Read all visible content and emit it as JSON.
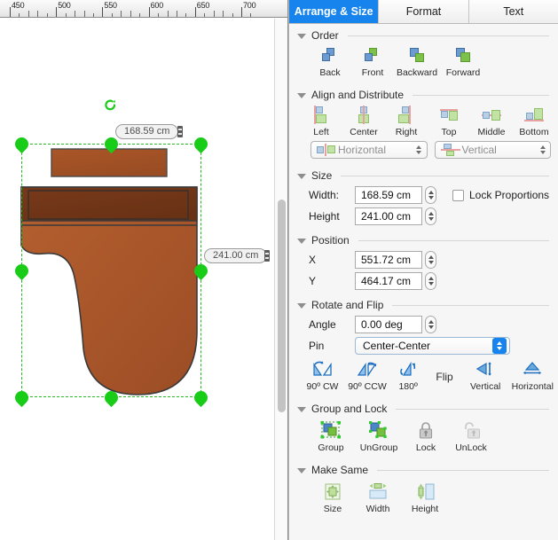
{
  "canvas": {
    "ruler": {
      "unit_labels": [
        "450",
        "500",
        "550",
        "600",
        "650",
        "700"
      ],
      "start": 450,
      "end": 710
    },
    "selection": {
      "width_badge": "168.59 cm",
      "height_badge": "241.00 cm",
      "handle_color": "#18cc18",
      "guide_color": "#22bb22",
      "rotate_icon": "rotate-handle-icon"
    },
    "shape": {
      "name": "bed-shape",
      "fill_color": "#a8552a",
      "dark_fill_color": "#6e3517",
      "stroke_color": "#3b3b3b"
    },
    "scrollbar": {
      "name": "vertical-scrollbar"
    }
  },
  "inspector": {
    "tabs": [
      {
        "label": "Arrange & Size",
        "active": true
      },
      {
        "label": "Format",
        "active": false
      },
      {
        "label": "Text",
        "active": false
      }
    ],
    "order": {
      "title": "Order",
      "buttons": [
        {
          "label": "Back",
          "icon": "send-to-back-icon"
        },
        {
          "label": "Front",
          "icon": "bring-to-front-icon"
        },
        {
          "label": "Backward",
          "icon": "send-backward-icon"
        },
        {
          "label": "Forward",
          "icon": "bring-forward-icon"
        }
      ]
    },
    "align": {
      "title": "Align and Distribute",
      "buttons": [
        {
          "label": "Left",
          "icon": "align-left-icon"
        },
        {
          "label": "Center",
          "icon": "align-center-icon"
        },
        {
          "label": "Right",
          "icon": "align-right-icon"
        },
        {
          "label": "Top",
          "icon": "align-top-icon"
        },
        {
          "label": "Middle",
          "icon": "align-middle-icon"
        },
        {
          "label": "Bottom",
          "icon": "align-bottom-icon"
        }
      ],
      "distribute_horizontal": "Horizontal",
      "distribute_vertical": "Vertical"
    },
    "size": {
      "title": "Size",
      "width_label": "Width:",
      "width_value": "168.59 cm",
      "height_label": "Height",
      "height_value": "241.00 cm",
      "lock_proportions_label": "Lock Proportions",
      "lock_proportions_checked": false
    },
    "position": {
      "title": "Position",
      "x_label": "X",
      "x_value": "551.72 cm",
      "y_label": "Y",
      "y_value": "464.17 cm"
    },
    "rotate": {
      "title": "Rotate and Flip",
      "angle_label": "Angle",
      "angle_value": "0.00 deg",
      "pin_label": "Pin",
      "pin_value": "Center-Center",
      "buttons": [
        {
          "label": "90º CW",
          "icon": "rotate-90-cw-icon"
        },
        {
          "label": "90º CCW",
          "icon": "rotate-90-ccw-icon"
        },
        {
          "label": "180º",
          "icon": "rotate-180-icon"
        }
      ],
      "flip_label": "Flip",
      "flip_buttons": [
        {
          "label": "Vertical",
          "icon": "flip-vertical-icon"
        },
        {
          "label": "Horizontal",
          "icon": "flip-horizontal-icon"
        }
      ]
    },
    "group": {
      "title": "Group and Lock",
      "buttons": [
        {
          "label": "Group",
          "icon": "group-icon"
        },
        {
          "label": "UnGroup",
          "icon": "ungroup-icon"
        },
        {
          "label": "Lock",
          "icon": "lock-closed-icon"
        },
        {
          "label": "UnLock",
          "icon": "lock-open-icon"
        }
      ]
    },
    "makesame": {
      "title": "Make Same",
      "buttons": [
        {
          "label": "Size",
          "icon": "make-same-size-icon"
        },
        {
          "label": "Width",
          "icon": "make-same-width-icon"
        },
        {
          "label": "Height",
          "icon": "make-same-height-icon"
        }
      ]
    }
  }
}
